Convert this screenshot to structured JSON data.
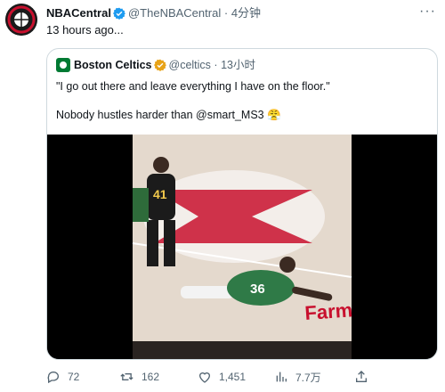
{
  "tweet": {
    "author": "NBACentral",
    "handle": "@TheNBACentral",
    "separator": "·",
    "time": "4分钟",
    "subtext": "13 hours ago...",
    "more_label": "···"
  },
  "quoted": {
    "author": "Boston Celtics",
    "handle": "@celtics",
    "separator": "·",
    "time": "13小时",
    "text_line1": "\"I go out there and leave everything I have on the floor.\"",
    "text_line2": "Nobody hustles harder than @smart_MS3 😤"
  },
  "video": {
    "floor_text": "Farm",
    "player_number_1": "41",
    "player_number_2": "36"
  },
  "actions": {
    "replies": "72",
    "retweets": "162",
    "likes": "1,451",
    "views": "7.7万"
  },
  "colors": {
    "text": "#0f1419",
    "muted": "#536471",
    "verified": "#1d9bf0",
    "celtics_green": "#007a33",
    "hawks_red": "#c8102e"
  },
  "icons": [
    "verified-badge-icon",
    "more-icon",
    "reply-icon",
    "retweet-icon",
    "like-icon",
    "views-icon",
    "share-icon"
  ]
}
